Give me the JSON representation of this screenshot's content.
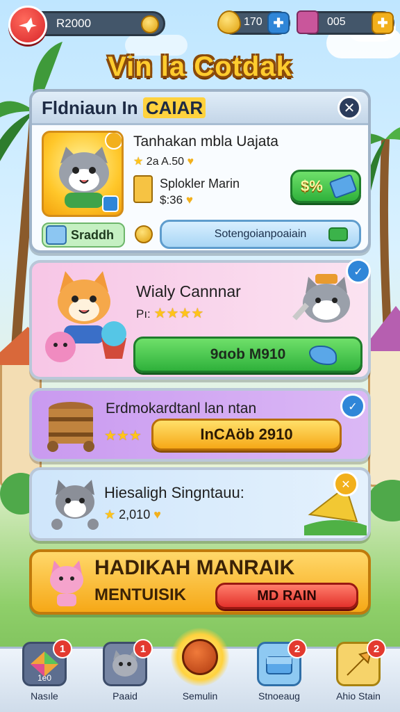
{
  "top_bar": {
    "coins": "R2000",
    "gems": "170",
    "tickets": "005"
  },
  "title": "Vin la Cotdak",
  "panel_main": {
    "title_prefix": "Fldniaun In ",
    "title_highlight": "CAIAR",
    "reward_title": "Tanhakan mbla Uajata",
    "reward_price": "2a A.50",
    "item_name": "Splokler Marin",
    "item_price": "$:36",
    "discount_label": "$%",
    "tag_label": "Sraddh",
    "wide_button": "Sotengoianpoaiain"
  },
  "panel_offer1": {
    "title": "Wialy Cannnar",
    "rating_prefix": "Pı:",
    "button": "9ɑob M910"
  },
  "panel_offer2": {
    "title": "Erdmokardtanl lan ntan",
    "button": "InCAöb 2910"
  },
  "panel_offer3": {
    "title": "Hiesaligh Singntauu:",
    "price": "2,010"
  },
  "banner": {
    "title": "HADIKAH MANRAIK",
    "subtitle": "MENTUISIK",
    "button": "MD RAIN"
  },
  "nav": [
    {
      "label": "Nasıle",
      "badge": "1",
      "caption": "1e0"
    },
    {
      "label": "Paaid",
      "badge": "1"
    },
    {
      "label": "Semulin"
    },
    {
      "label": "Stnoeaug",
      "badge": "2"
    },
    {
      "label": "Ahio Stain",
      "badge": "2"
    }
  ],
  "colors": {
    "accent_gold": "#ffcc2e",
    "panel_border": "#9fb3c8",
    "green_button": "#2fb13b",
    "orange_button": "#f6a817",
    "red_button": "#e3322c",
    "offer1_bg": "#f7c6e6",
    "offer2_bg": "#c99af0",
    "offer3_bg": "#cfe6fb"
  }
}
